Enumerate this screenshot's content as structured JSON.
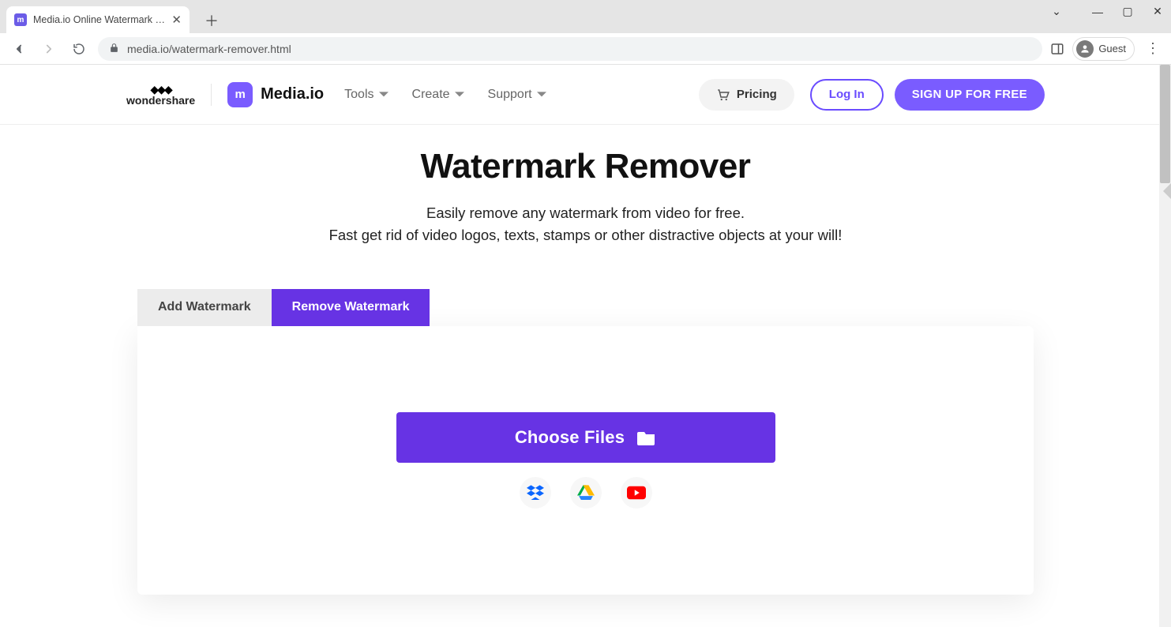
{
  "browser": {
    "tab_title": "Media.io Online Watermark Remo",
    "url": "media.io/watermark-remover.html",
    "guest_label": "Guest"
  },
  "header": {
    "company": "wondershare",
    "brand_mark": "m",
    "brand_name": "Media.io",
    "nav": {
      "tools": "Tools",
      "create": "Create",
      "support": "Support"
    },
    "pricing": "Pricing",
    "login": "Log In",
    "signup": "SIGN UP FOR FREE"
  },
  "hero": {
    "title": "Watermark Remover",
    "line1": "Easily remove any watermark from video for free.",
    "line2": "Fast get rid of video logos, texts, stamps or other distractive objects at your will!"
  },
  "tool": {
    "tabs": {
      "add": "Add Watermark",
      "remove": "Remove Watermark"
    },
    "choose": "Choose Files",
    "sources": {
      "dropbox": "dropbox",
      "drive": "google-drive",
      "youtube": "youtube"
    }
  }
}
